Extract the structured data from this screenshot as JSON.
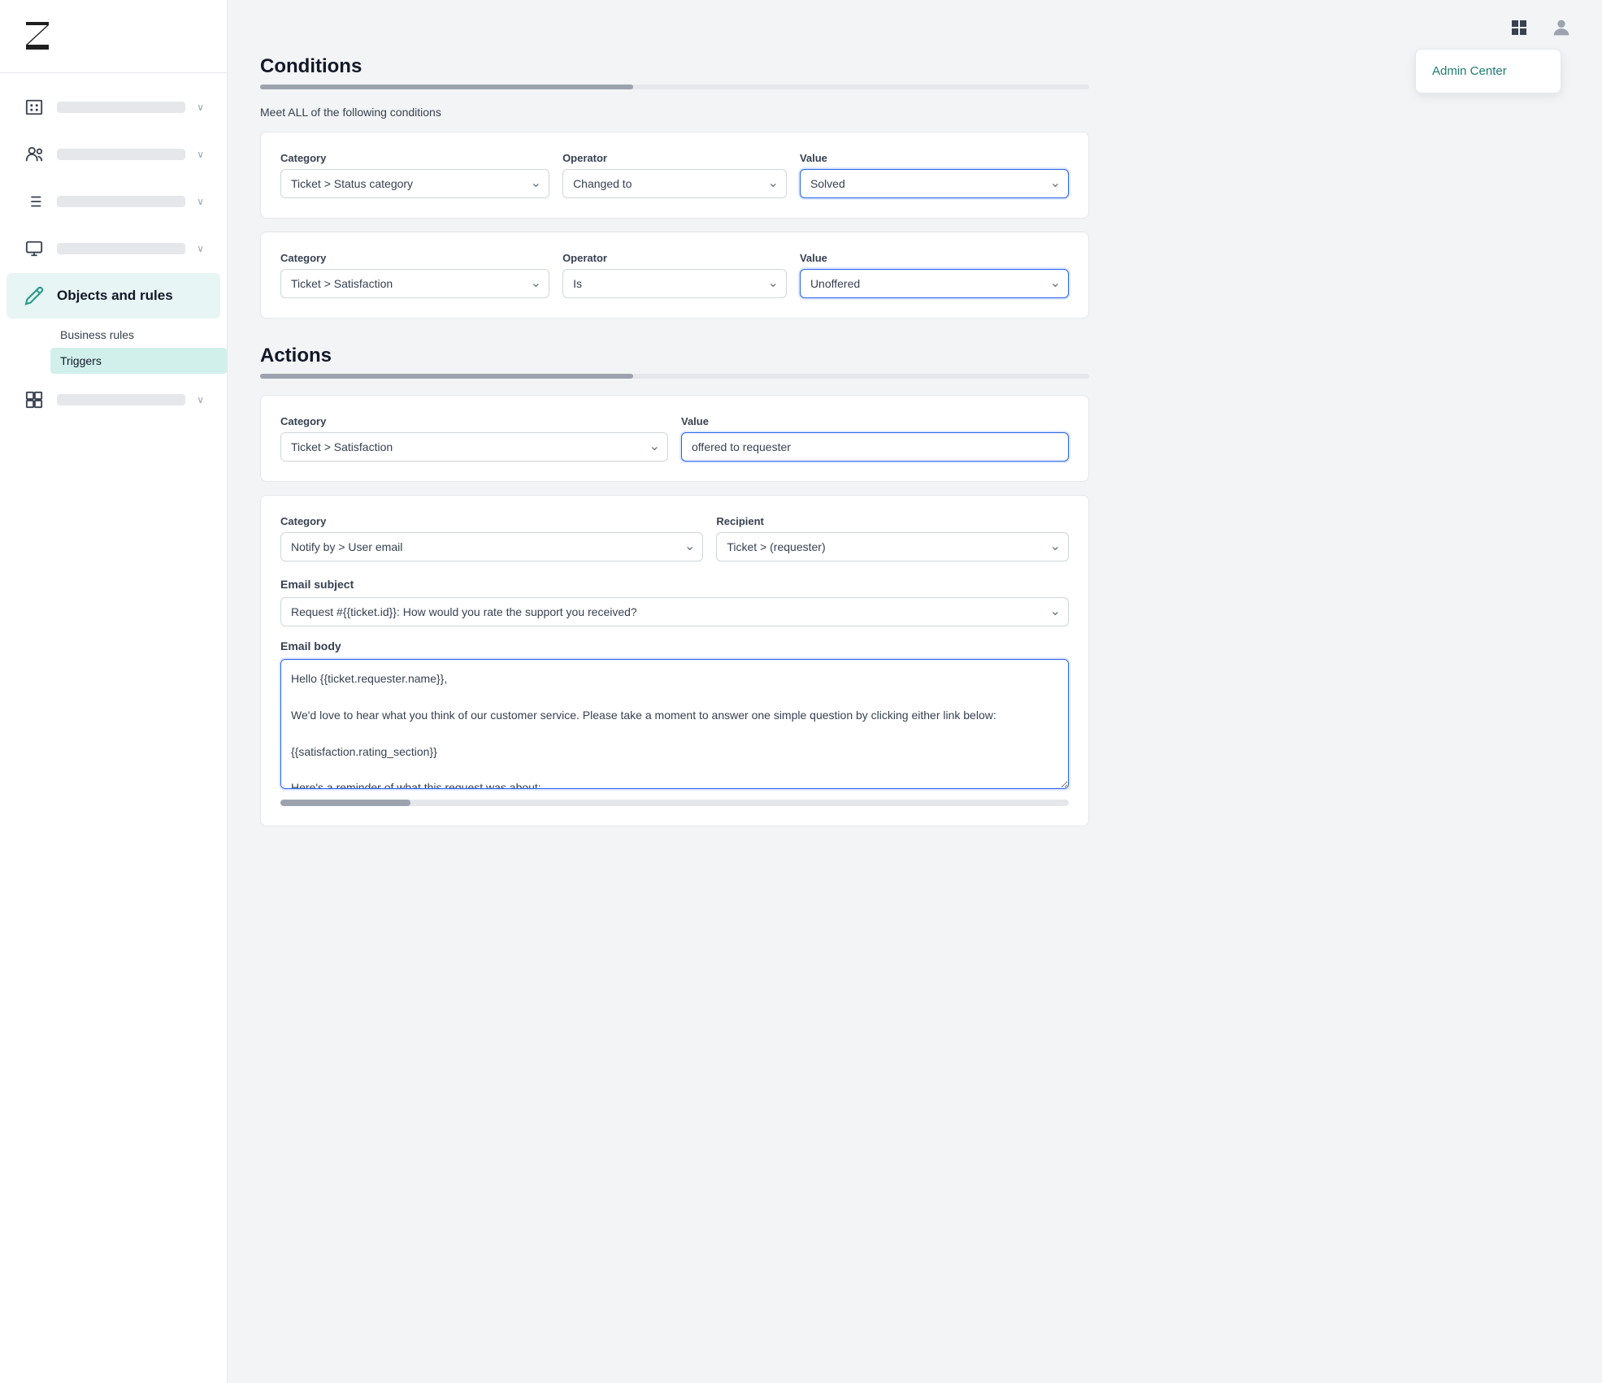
{
  "sidebar": {
    "logo_alt": "Zendesk logo",
    "nav_items": [
      {
        "id": "organization",
        "label_placeholder": "Organization",
        "active": false,
        "has_chevron": true
      },
      {
        "id": "people",
        "label_placeholder": "People",
        "active": false,
        "has_chevron": true
      },
      {
        "id": "channels",
        "label_placeholder": "Channels",
        "active": false,
        "has_chevron": true
      },
      {
        "id": "workspace",
        "label_placeholder": "Workspace",
        "active": false,
        "has_chevron": true
      },
      {
        "id": "objects-rules",
        "label": "Objects and rules",
        "active": true,
        "has_chevron": false
      },
      {
        "id": "apps",
        "label_placeholder": "Apps",
        "active": false,
        "has_chevron": true
      }
    ],
    "sub_items": [
      {
        "id": "business-rules",
        "label": "Business rules",
        "active": false
      },
      {
        "id": "triggers",
        "label": "Triggers",
        "active": true
      }
    ]
  },
  "topbar": {
    "grid_icon": "⊞",
    "user_icon": "👤",
    "admin_center_label": "Admin Center"
  },
  "conditions": {
    "title": "Conditions",
    "description": "Meet ALL of the following conditions",
    "rows": [
      {
        "category_label": "Category",
        "category_value": "Ticket > Status category",
        "operator_label": "Operator",
        "operator_value": "Changed to",
        "value_label": "Value",
        "value_value": "Solved",
        "value_active": true
      },
      {
        "category_label": "Category",
        "category_value": "Ticket > Satisfaction",
        "operator_label": "Operator",
        "operator_value": "Is",
        "value_label": "Value",
        "value_value": "Unoffered",
        "value_active": true
      }
    ]
  },
  "actions": {
    "title": "Actions",
    "rows": [
      {
        "category_label": "Category",
        "category_value": "Ticket > Satisfaction",
        "value_label": "Value",
        "value_value": "offered to requester",
        "value_active": true
      },
      {
        "category_label": "Category",
        "category_value": "Notify by > User email",
        "recipient_label": "Recipient",
        "recipient_value": "Ticket > (requester)"
      }
    ],
    "email_subject_label": "Email subject",
    "email_subject_value": "Request #{{ticket.id}}: How would you rate the support you received?",
    "email_body_label": "Email body",
    "email_body_value": "Hello {{ticket.requester.name}},\n\nWe'd love to hear what you think of our customer service. Please take a moment to answer one simple question by clicking either link below:\n\n{{satisfaction.rating_section}}\n\nHere's a reminder of what this request was about:"
  }
}
